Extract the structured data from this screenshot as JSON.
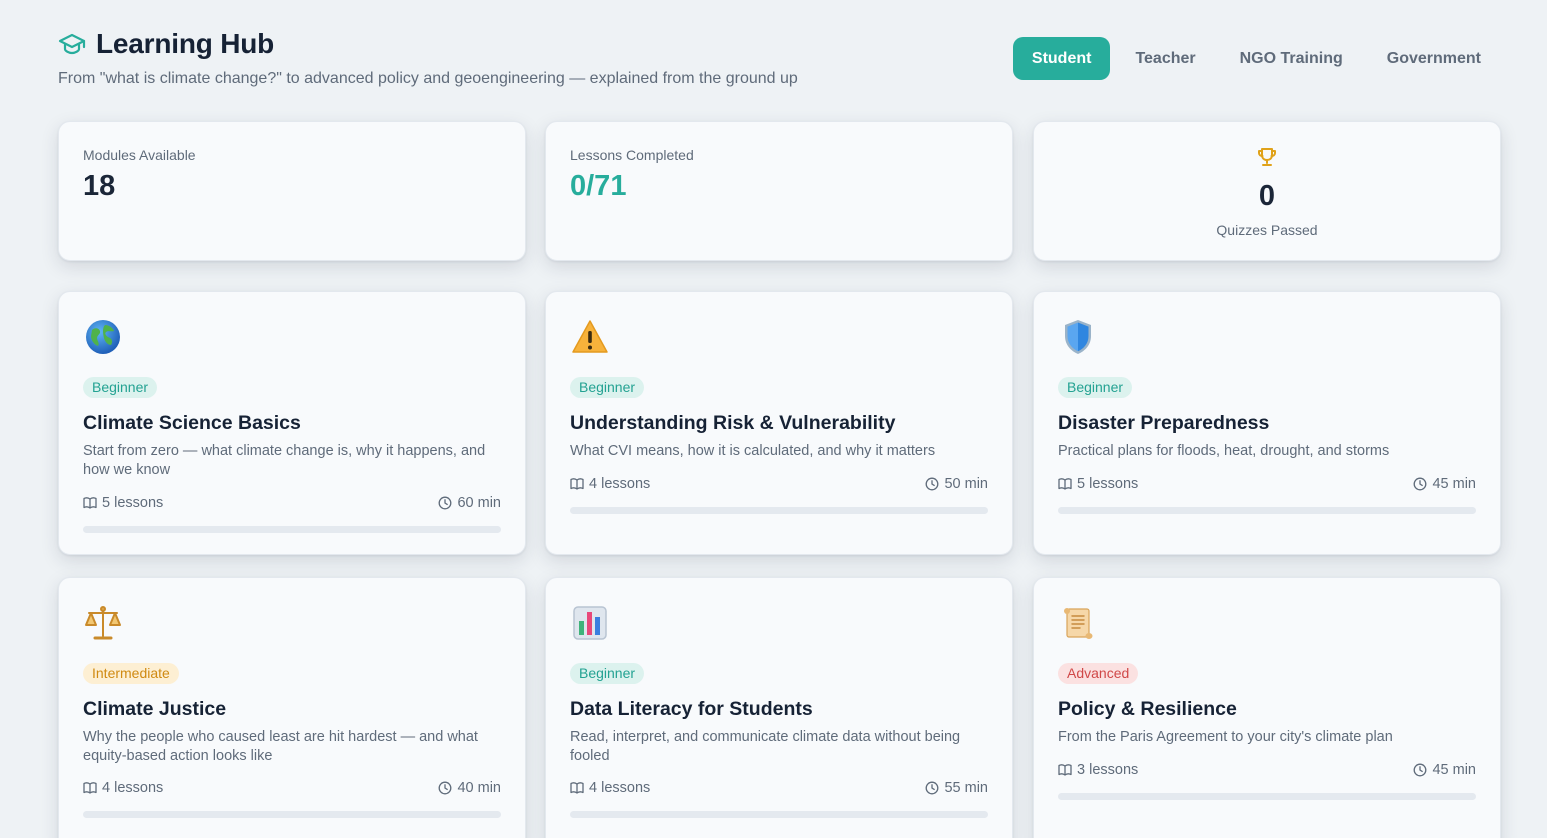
{
  "header": {
    "title": "Learning Hub",
    "subtitle": "From \"what is climate change?\" to advanced policy and geoengineering — explained from the ground up",
    "icon": "graduation-cap-icon",
    "tabs": [
      {
        "label": "Student",
        "active": true
      },
      {
        "label": "Teacher",
        "active": false
      },
      {
        "label": "NGO Training",
        "active": false
      },
      {
        "label": "Government",
        "active": false
      }
    ]
  },
  "stats": {
    "modules": {
      "label": "Modules Available",
      "value": "18"
    },
    "lessons": {
      "label": "Lessons Completed",
      "value": "0/71"
    },
    "quizzes": {
      "label": "Quizzes Passed",
      "value": "0",
      "icon": "trophy-icon"
    }
  },
  "colors": {
    "accent": "#27ad9c",
    "beginner": "#23a292",
    "intermediate": "#d08a12",
    "advanced": "#d04848"
  },
  "modules": [
    {
      "icon": "globe-icon",
      "level": "Beginner",
      "title": "Climate Science Basics",
      "description": "Start from zero — what climate change is, why it happens, and how we know",
      "lessons": "5 lessons",
      "duration": "60 min",
      "progress": 0
    },
    {
      "icon": "warning-icon",
      "level": "Beginner",
      "title": "Understanding Risk & Vulnerability",
      "description": "What CVI means, how it is calculated, and why it matters",
      "lessons": "4 lessons",
      "duration": "50 min",
      "progress": 0
    },
    {
      "icon": "shield-icon",
      "level": "Beginner",
      "title": "Disaster Preparedness",
      "description": "Practical plans for floods, heat, drought, and storms",
      "lessons": "5 lessons",
      "duration": "45 min",
      "progress": 0
    },
    {
      "icon": "scales-icon",
      "level": "Intermediate",
      "title": "Climate Justice",
      "description": "Why the people who caused least are hit hardest — and what equity-based action looks like",
      "lessons": "4 lessons",
      "duration": "40 min",
      "progress": 0
    },
    {
      "icon": "bar-chart-icon",
      "level": "Beginner",
      "title": "Data Literacy for Students",
      "description": "Read, interpret, and communicate climate data without being fooled",
      "lessons": "4 lessons",
      "duration": "55 min",
      "progress": 0
    },
    {
      "icon": "scroll-icon",
      "level": "Advanced",
      "title": "Policy & Resilience",
      "description": "From the Paris Agreement to your city's climate plan",
      "lessons": "3 lessons",
      "duration": "45 min",
      "progress": 0
    }
  ]
}
